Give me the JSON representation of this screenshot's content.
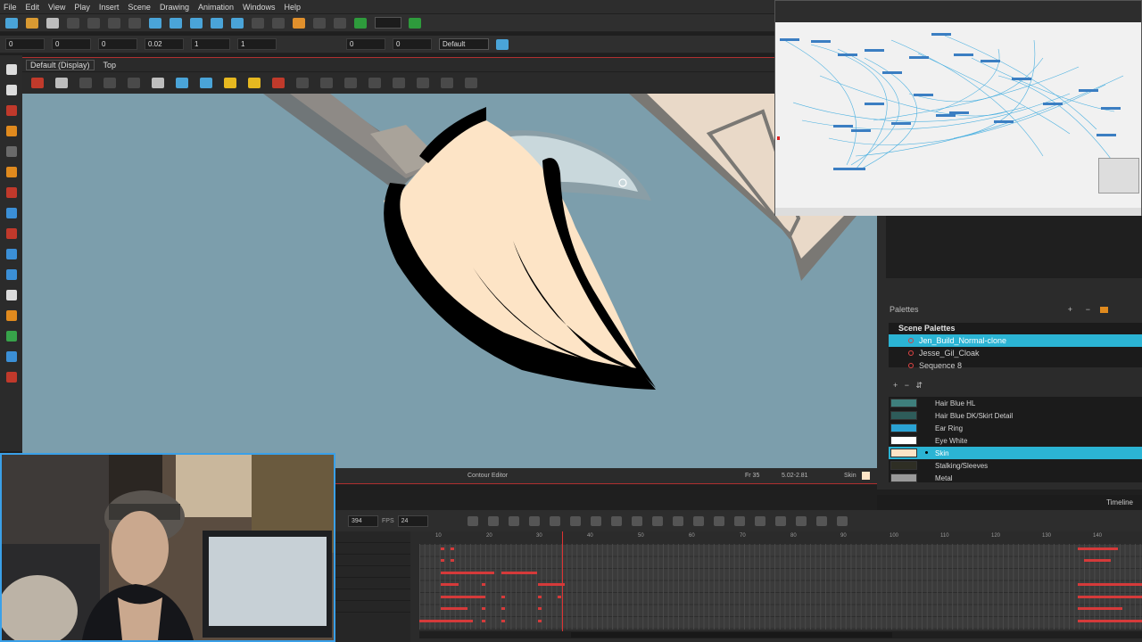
{
  "menu": [
    "File",
    "Edit",
    "View",
    "Play",
    "Insert",
    "Scene",
    "Drawing",
    "Animation",
    "Windows",
    "Help"
  ],
  "toolbar2": {
    "fields": [
      "0",
      "0",
      "0",
      "0.02",
      "1",
      "1",
      "0",
      "0"
    ],
    "preset": "Default"
  },
  "view": {
    "display": "Default (Display)",
    "mode": "Top"
  },
  "canvas": {
    "background": "#7c9eac",
    "skin_color": "#fde4c6",
    "outline_color": "#000000"
  },
  "status": {
    "editor": "Contour Editor",
    "frame": "Fr 35",
    "coords": "5.02-2.81",
    "color_name": "Skin"
  },
  "palettes": {
    "header": "Palettes",
    "scene_title": "Scene Palettes",
    "items": [
      "Jen_Build_Normal-clone",
      "Jesse_Gil_Cloak",
      "Sequence 8"
    ],
    "selected": "Jen_Build_Normal-clone"
  },
  "colors": [
    {
      "name": "Hair Blue HL",
      "hex": "#3e7f7c"
    },
    {
      "name": "Hair Blue DK/Skirt Detail",
      "hex": "#2e5c5a"
    },
    {
      "name": "Ear Ring",
      "hex": "#2aa3d4"
    },
    {
      "name": "Eye White",
      "hex": "#ffffff"
    },
    {
      "name": "Skin",
      "hex": "#fde4c6",
      "selected": true
    },
    {
      "name": "Stalking/Sleeves",
      "hex": "#2e2e24"
    },
    {
      "name": "Metal",
      "hex": "#9a9a9a"
    }
  ],
  "timeline": {
    "tab": "Timeline",
    "end_frame": "394",
    "fps_label": "FPS",
    "fps": "24",
    "ruler": [
      "10",
      "20",
      "30",
      "40",
      "50",
      "60",
      "70",
      "80",
      "90",
      "100",
      "110",
      "120",
      "130",
      "140"
    ],
    "current_frame": 35
  }
}
